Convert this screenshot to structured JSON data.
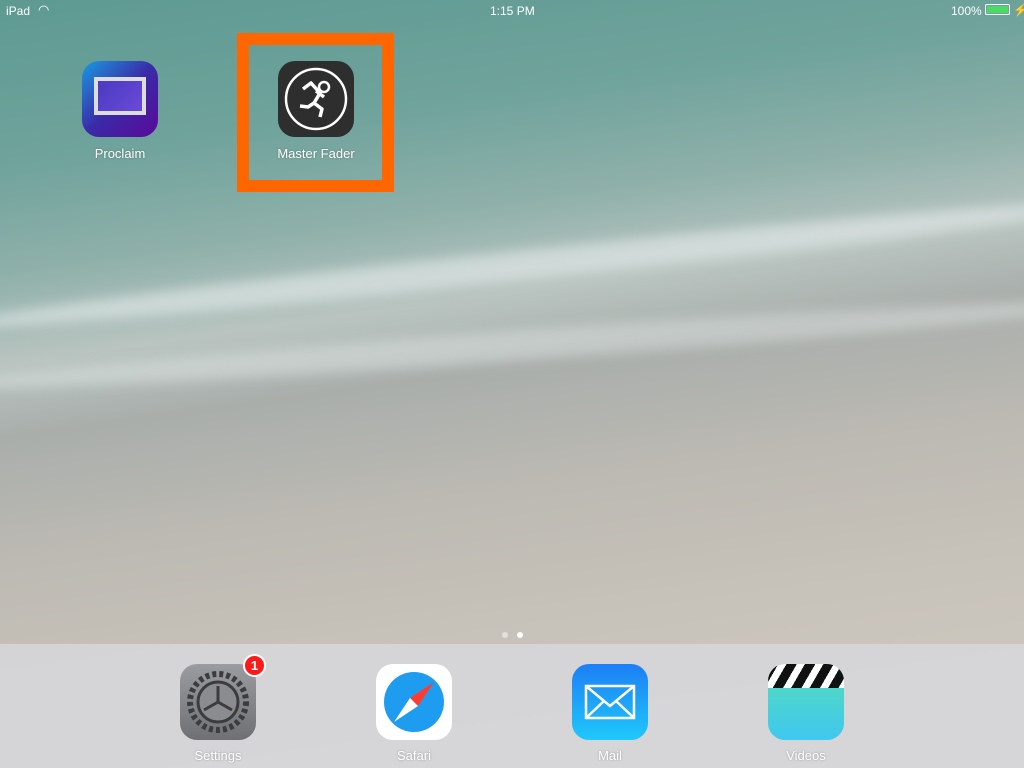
{
  "status_bar": {
    "device": "iPad",
    "time": "1:15 PM",
    "battery": "100%"
  },
  "home_apps": [
    {
      "label": "Proclaim"
    },
    {
      "label": "Master Fader"
    }
  ],
  "page_indicator": {
    "pages": 2,
    "current": 2
  },
  "dock": [
    {
      "label": "Settings",
      "badge": "1"
    },
    {
      "label": "Safari"
    },
    {
      "label": "Mail"
    },
    {
      "label": "Videos"
    }
  ],
  "colors": {
    "highlight": "#ff6600",
    "badge": "#ff1a1a"
  }
}
